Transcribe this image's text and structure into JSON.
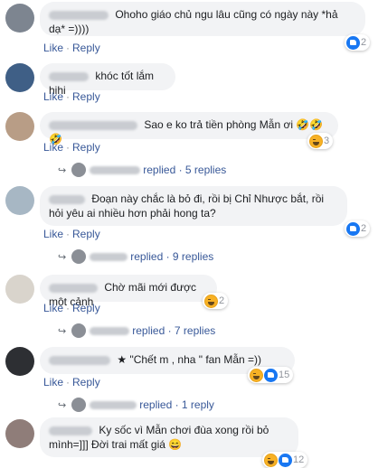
{
  "actions": {
    "like": "Like",
    "reply": "Reply",
    "sep": "·"
  },
  "comments": [
    {
      "text": "Ohoho giáo chủ ngu lâu cũng có ngày này *hả dạ* =))))",
      "reaction_count": "2",
      "reactions": [
        "like-icon"
      ]
    },
    {
      "text": "khóc tốt lắm hihi"
    },
    {
      "text": "Sao e ko trả tiền phòng Mẫn ơi 🤣🤣🤣",
      "reaction_count": "3",
      "reactions": [
        "haha-icon"
      ]
    },
    {
      "text": "Đoạn này chắc là bỏ đi, rồi bị Chỉ Nhược bắt, rồi hỏi yêu ai nhiều hơn phải hong ta?",
      "reaction_count": "2",
      "reactions": [
        "like-icon"
      ]
    },
    {
      "text": "Chờ mãi mới được một cảnh",
      "reaction_count": "2",
      "reactions": [
        "haha-icon"
      ]
    },
    {
      "text": "\"Chết m       , nha       \" fan Mẫn =))",
      "reaction_count": "15",
      "reactions": [
        "haha-icon",
        "like-icon"
      ]
    },
    {
      "text": "Ky sốc vì Mẫn chơi đùa xong rồi bỏ mình=]]] Đời trai mất giá 😄",
      "reaction_count": "12",
      "reactions": [
        "haha-icon",
        "like-icon"
      ]
    }
  ],
  "reply_threads": [
    {
      "text": "replied · 5 replies"
    },
    {
      "text": "replied · 9 replies"
    },
    {
      "text": "replied · 7 replies"
    },
    {
      "text": "replied · 1 reply"
    }
  ],
  "colors": {
    "link": "#385898",
    "bubble": "#f2f3f5",
    "like": "#1877f2",
    "haha": "#f7b125"
  }
}
